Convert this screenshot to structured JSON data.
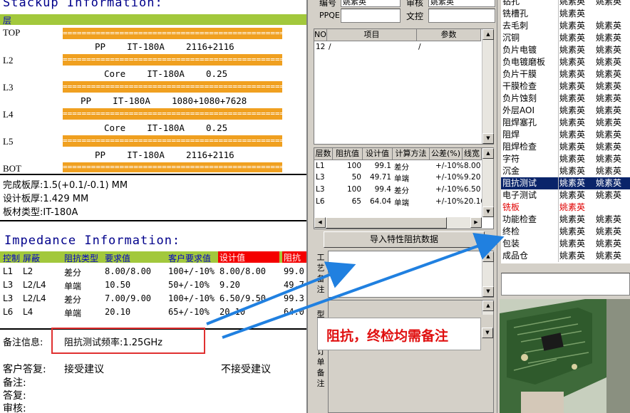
{
  "stackup": {
    "title": "Stackup Information:",
    "header_label": "层",
    "separator": "====================================================",
    "layers": [
      "TOP",
      "L2",
      "L3",
      "L4",
      "L5",
      "BOT"
    ],
    "dielectrics": [
      {
        "type": "PP",
        "material": "IT-180A",
        "spec": "2116+2116"
      },
      {
        "type": "Core",
        "material": "IT-180A",
        "spec": "0.25"
      },
      {
        "type": "PP",
        "material": "IT-180A",
        "spec": "1080+1080+7628"
      },
      {
        "type": "Core",
        "material": "IT-180A",
        "spec": "0.25"
      },
      {
        "type": "PP",
        "material": "IT-180A",
        "spec": "2116+2116"
      }
    ],
    "finished_thickness": "完成板厚:1.5(+0.1/-0.1) MM",
    "design_thickness": "设计板厚:1.429 MM",
    "material_type": "板材类型:IT-180A"
  },
  "impedance": {
    "title": "Impedance Information:",
    "headers": [
      "控制",
      "屏蔽",
      "阻抗类型",
      "要求值",
      "客户要求值",
      "设计值",
      "阻抗"
    ],
    "rows": [
      {
        "ctrl": "L1",
        "shield": "L2",
        "type": "差分",
        "req": "8.00/8.00",
        "cust": "100+/-10%",
        "design": "8.00/8.00",
        "imp": "99.0"
      },
      {
        "ctrl": "L3",
        "shield": "L2/L4",
        "type": "单端",
        "req": "10.50",
        "cust": "50+/-10%",
        "design": "9.20",
        "imp": "49.7"
      },
      {
        "ctrl": "L3",
        "shield": "L2/L4",
        "type": "差分",
        "req": "7.00/9.00",
        "cust": "100+/-10%",
        "design": "6.50/9.50",
        "imp": "99.3"
      },
      {
        "ctrl": "L6",
        "shield": "L4",
        "type": "单端",
        "req": "20.10",
        "cust": "65+/-10%",
        "design": "20.10",
        "imp": "64.0"
      }
    ]
  },
  "remarks": {
    "label": "备注信息:",
    "value": "阻抗测试频率:1.25GHz",
    "customer_reply_label": "客户答复:",
    "accept": "接受建议",
    "reject": "不接受建议",
    "note_label": "备注:",
    "reply_label": "答复:",
    "review_label": "审核:"
  },
  "form": {
    "top_label_1": "编号",
    "top_value_1": "姚素英",
    "top_label_2": "审核",
    "top_value_2": "姚素英",
    "ppqe_label": "PPQE",
    "doc_control_label": "文控"
  },
  "param_grid": {
    "headers": [
      "NO",
      "项目",
      "参数"
    ],
    "rows": [
      {
        "no": "12",
        "item": "/",
        "param": "/"
      }
    ]
  },
  "imp_grid": {
    "headers": [
      "层数",
      "阻抗值",
      "设计值",
      "计算方法",
      "公差(%)",
      "线宽"
    ],
    "rows": [
      {
        "layer": "L1",
        "imp": "100",
        "design": "99.1",
        "method": "差分",
        "tol": "+/-10%",
        "width": "8.00"
      },
      {
        "layer": "L3",
        "imp": "50",
        "design": "49.71",
        "method": "单端",
        "tol": "+/-10%",
        "width": "9.20"
      },
      {
        "layer": "L3",
        "imp": "100",
        "design": "99.4",
        "method": "差分",
        "tol": "+/-10%",
        "width": "6.50"
      },
      {
        "layer": "L6",
        "imp": "65",
        "design": "64.04",
        "method": "单端",
        "tol": "+/-10%",
        "width": "20.10"
      }
    ]
  },
  "import_button": "导入特性阻抗数据",
  "side_tabs": {
    "process_notes": "工艺备注",
    "type_label": "型",
    "order_notes": "订单备注"
  },
  "annotation": "阻抗，终检均需备注",
  "process_list": [
    {
      "name": "钻孔",
      "a": "姚素英",
      "b": "姚素英",
      "style": "normal"
    },
    {
      "name": "铣槽孔",
      "a": "姚素英",
      "b": "",
      "style": "normal"
    },
    {
      "name": "去毛刺",
      "a": "姚素英",
      "b": "姚素英",
      "style": "normal"
    },
    {
      "name": "沉铜",
      "a": "姚素英",
      "b": "姚素英",
      "style": "normal"
    },
    {
      "name": "负片电镀",
      "a": "姚素英",
      "b": "姚素英",
      "style": "normal"
    },
    {
      "name": "负电镀磨板",
      "a": "姚素英",
      "b": "姚素英",
      "style": "normal"
    },
    {
      "name": "负片干膜",
      "a": "姚素英",
      "b": "姚素英",
      "style": "normal"
    },
    {
      "name": "干膜检查",
      "a": "姚素英",
      "b": "姚素英",
      "style": "normal"
    },
    {
      "name": "负片蚀刻",
      "a": "姚素英",
      "b": "姚素英",
      "style": "normal"
    },
    {
      "name": "外层AOI",
      "a": "姚素英",
      "b": "姚素英",
      "style": "normal"
    },
    {
      "name": "阻焊塞孔",
      "a": "姚素英",
      "b": "姚素英",
      "style": "normal"
    },
    {
      "name": "阻焊",
      "a": "姚素英",
      "b": "姚素英",
      "style": "normal"
    },
    {
      "name": "阻焊检查",
      "a": "姚素英",
      "b": "姚素英",
      "style": "normal"
    },
    {
      "name": "字符",
      "a": "姚素英",
      "b": "姚素英",
      "style": "normal"
    },
    {
      "name": "沉金",
      "a": "姚素英",
      "b": "姚素英",
      "style": "normal"
    },
    {
      "name": "阻抗测试",
      "a": "姚素英",
      "b": "姚素英",
      "style": "selected"
    },
    {
      "name": "电子测试",
      "a": "姚素英",
      "b": "姚素英",
      "style": "normal"
    },
    {
      "name": "铣板",
      "a": "姚素英",
      "b": "",
      "style": "red"
    },
    {
      "name": "功能检查",
      "a": "姚素英",
      "b": "姚素英",
      "style": "normal"
    },
    {
      "name": "终检",
      "a": "姚素英",
      "b": "姚素英",
      "style": "normal"
    },
    {
      "name": "包装",
      "a": "姚素英",
      "b": "姚素英",
      "style": "normal"
    },
    {
      "name": "成品仓",
      "a": "姚素英",
      "b": "姚素英",
      "style": "normal"
    }
  ],
  "colors": {
    "title_blue": "#00008b",
    "header_green": "#a2c83c",
    "layer_orange": "#f0a020",
    "highlight_red": "#f40000",
    "selection_navy": "#0a246a",
    "annotation_arrow": "#2080e0"
  }
}
